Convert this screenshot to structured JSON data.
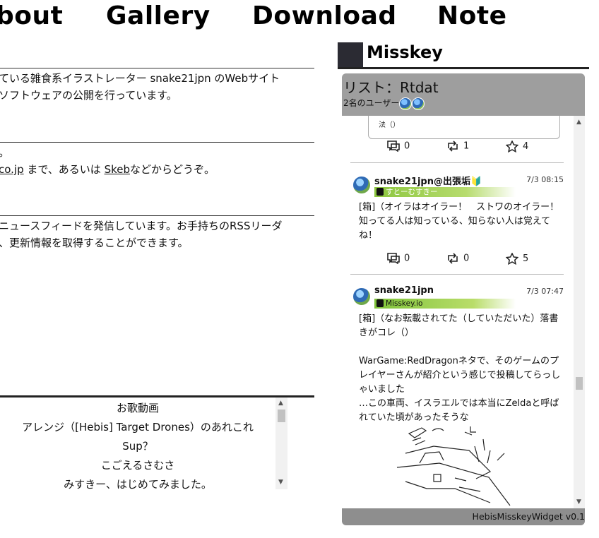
{
  "nav": {
    "about": "bout",
    "gallery": "Gallery",
    "download": "Download",
    "note": "Note"
  },
  "intro": {
    "line1": "ている雑食系イラストレーター snake21jpn のWebサイト",
    "line2": "ソフトウェアの公開を行っています。"
  },
  "contact": {
    "line1": "。",
    "link1": "co.jp",
    "mid": " まで、あるいは ",
    "link2": "Skeb",
    "end": "などからどうぞ。"
  },
  "rss": {
    "line1": "ニュースフィードを発信しています。お手持ちのRSSリーダ",
    "line2": "、更新情報を取得することができます。"
  },
  "videos": [
    "お歌動画",
    "アレンジ（[Hebis] Target Drones）のあれこれ",
    "Sup？",
    "こごえるさむさ",
    "みすきー、はじめてみました。"
  ],
  "misskey": {
    "title": "Misskey",
    "list_title": "リスト：Rtdat",
    "users": "2名のユーザー",
    "footer": "HebisMisskeyWidget v0.1",
    "quote_text": "法（）",
    "top_actions": {
      "replies": "0",
      "renotes": "1",
      "reactions": "4"
    },
    "notes": [
      {
        "user": "snake21jpn@出張垢🔰",
        "time": "7/3 08:15",
        "instance": "すとーむすきー",
        "text": "[箱]（オイラはオイラー！　ストワのオイラー！知ってる人は知っている、知らない人は覚えてね！",
        "replies": "0",
        "renotes": "0",
        "reactions": "5"
      },
      {
        "user": "snake21jpn",
        "time": "7/3 07:47",
        "instance": "Misskey.io",
        "text_lines": [
          "[箱]（なお転載されてた（していただいた）落書",
          "きがコレ（）",
          "",
          "WarGame:RedDragonネタで、そのゲームのプ",
          "レイヤーさんが紹介という感じで投稿してらっし",
          "ゃいました",
          "…この車両、イスラエルでは本当にZeldaと呼ば",
          "れていた頃があったそうな"
        ]
      }
    ]
  },
  "colors": {
    "header_gray": "#9e9e9e",
    "footer_gray": "#8e8e8e",
    "instance_green": "#8cc63f"
  }
}
